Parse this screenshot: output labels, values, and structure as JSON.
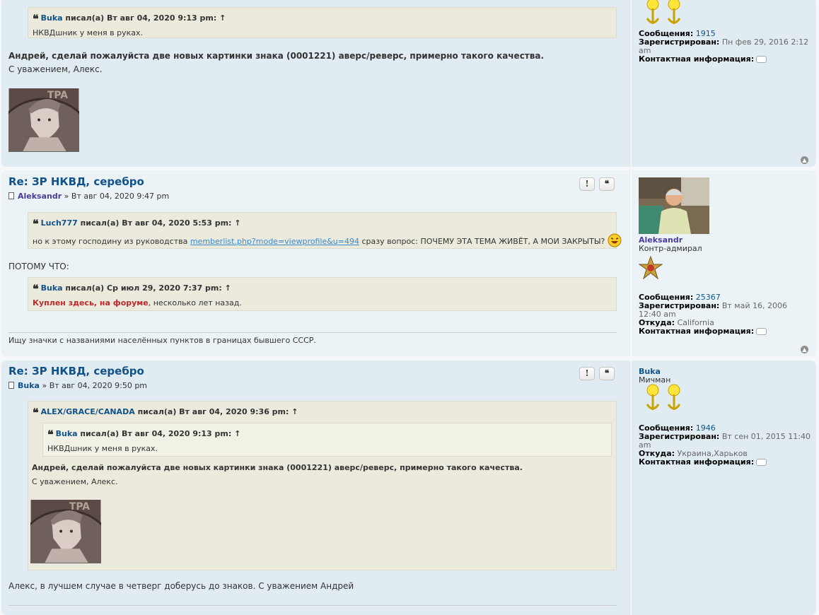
{
  "post1": {
    "quote": {
      "author": "Buka",
      "meta": "писал(а) Вт авг 04, 2020 9:13 pm:",
      "arrow": "↑",
      "text": "НКВДшник у меня в руках."
    },
    "line1": "Андрей, сделай пожалуйста две новых картинки знака (0001221) аверс/реверс, примерно такого качества.",
    "line2": "С уважением, Алекс.",
    "profile": {
      "posts_label": "Сообщения:",
      "posts": "1915",
      "reg_label": "Зарегистрирован:",
      "reg": "Пн фев 29, 2016 2:12 am",
      "contact_label": "Контактная информация:"
    }
  },
  "post2": {
    "title": "Re: ЗР НКВД, серебро",
    "author": "Aleksandr",
    "date": "» Вт авг 04, 2020 9:47 pm",
    "quote1": {
      "author": "Luch777",
      "meta": "писал(а) Вт авг 04, 2020 5:53 pm:",
      "arrow": "↑",
      "text_before": "но к этому господину из руководства",
      "link": "memberlist.php?mode=viewprofile&u=494",
      "text_after": "сразу вопрос: ПОЧЕМУ ЭТА ТЕМА ЖИВЁТ, А МОИ ЗАКРЫТЫ?"
    },
    "middle": "ПОТОМУ ЧТО:",
    "quote2": {
      "author": "Buka",
      "meta": "писал(а) Ср июл 29, 2020 7:37 pm:",
      "arrow": "↑",
      "red": "Куплен здесь, на форуме",
      "rest": ", несколько лет назад."
    },
    "signature": "Ищу значки с названиями населённых пунктов в границах бывшего СССР.",
    "profile": {
      "name": "Aleksandr",
      "rank": "Контр-адмирал",
      "posts_label": "Сообщения:",
      "posts": "25367",
      "reg_label": "Зарегистрирован:",
      "reg": "Вт май 16, 2006 12:40 am",
      "from_label": "Откуда:",
      "from": "California",
      "contact_label": "Контактная информация:"
    }
  },
  "post3": {
    "title": "Re: ЗР НКВД, серебро",
    "author": "Buka",
    "date": "» Вт авг 04, 2020 9:50 pm",
    "quote_outer": {
      "author": "ALEX/GRACE/CANADA",
      "meta": "писал(а) Вт авг 04, 2020 9:36 pm:",
      "arrow": "↑"
    },
    "quote_inner": {
      "author": "Buka",
      "meta": "писал(а) Вт авг 04, 2020 9:13 pm:",
      "arrow": "↑",
      "text": "НКВДшник у меня в руках."
    },
    "line1": "Андрей, сделай пожалуйста две новых картинки знака (0001221) аверс/реверс, примерно такого качества.",
    "line2": "С уважением, Алекс.",
    "reply": "Алекс, в лучшем случае в четверг доберусь до знаков. С уважением Андрей",
    "profile": {
      "name": "Buka",
      "rank": "Мичман",
      "posts_label": "Сообщения:",
      "posts": "1946",
      "reg_label": "Зарегистрирован:",
      "reg": "Вт сен 01, 2015 11:40 am",
      "from_label": "Откуда:",
      "from": "Украина,Харьков",
      "contact_label": "Контактная информация:"
    }
  },
  "buttons": {
    "report": "!",
    "quote": "❝"
  },
  "icons": {
    "top": "top-arrow-icon",
    "contact": "contact-icon",
    "quote": "quote-icon"
  }
}
